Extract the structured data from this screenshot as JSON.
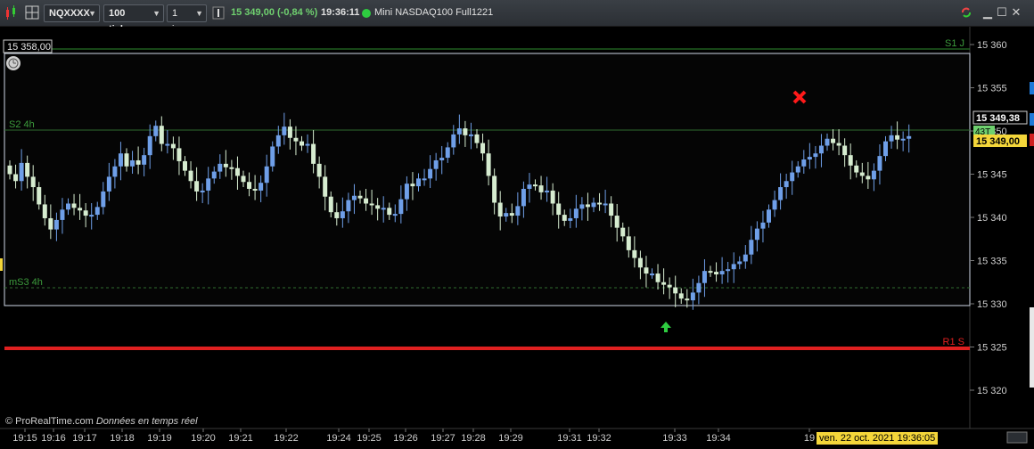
{
  "toolbar": {
    "symbol": "NQXXXX",
    "ticks": "100 ticks",
    "period": "1 jour",
    "price_change": "15 349,00 (-0,84 %)",
    "time": "19:36:11",
    "instrument": "Mini NASDAQ100 Full1221",
    "status_color": "#2ecc40",
    "icons": [
      "chart-type-icon",
      "grid-icon",
      "link-icon",
      "bar-icon",
      "refresh-icon",
      "minimize-icon",
      "maximize-icon",
      "close-icon"
    ]
  },
  "levels": {
    "s1j": "S1 J",
    "s2_4h": "S2 4h",
    "ms3_4h": "mS3 4h",
    "r1s": "R1 S",
    "top_price_label": "15 358,00"
  },
  "price_axis": {
    "ticks": [
      "15 360",
      "15 355",
      "15 350",
      "15 345",
      "15 340",
      "15 335",
      "15 330",
      "15 325",
      "15 320"
    ],
    "tick_values": [
      15360,
      15355,
      15350,
      15345,
      15340,
      15335,
      15330,
      15325,
      15320
    ],
    "last_price": "15 349,38",
    "current_price": "15 349,00",
    "tag": "43T"
  },
  "time_axis": {
    "labels": [
      "19:15",
      "19:16",
      "19:17",
      "19:18",
      "19:19",
      "19:20",
      "19:21",
      "19:22",
      "19:24",
      "19:25",
      "19:26",
      "19:27",
      "19:28",
      "19:29",
      "19:31",
      "19:32",
      "19:33",
      "19:34",
      "19"
    ]
  },
  "footer": {
    "brand": "© ProRealTime.com",
    "note": "Données en temps réel",
    "date": "ven. 22 oct. 2021 19:36:05"
  },
  "chart_data": {
    "type": "candlestick",
    "instrument": "Mini NASDAQ100 Full1221",
    "ylim": [
      15317.5,
      15362
    ],
    "levels": [
      {
        "name": "S1 J",
        "value": 15358.3,
        "color": "#2e8b2e"
      },
      {
        "name": "S2 4h",
        "value": 15349.0,
        "color": "#2e6b2e"
      },
      {
        "name": "mS3 4h",
        "value": 15331.3,
        "color": "#2e6b2e"
      },
      {
        "name": "R1 S",
        "value": 15324.6,
        "color": "#e02020"
      }
    ],
    "colors": {
      "up": "#6f9fe8",
      "down": "#d6ecd0"
    },
    "closes": [
      15345.0,
      15344.2,
      15346.3,
      15344.7,
      15343.5,
      15341.5,
      15339.9,
      15338.6,
      15339.7,
      15340.9,
      15341.6,
      15341.1,
      15340.8,
      15340.2,
      15340.3,
      15341.2,
      15343.0,
      15344.7,
      15345.9,
      15347.4,
      15345.9,
      15346.6,
      15346.1,
      15347.2,
      15349.4,
      15350.6,
      15348.5,
      15348.5,
      15348.0,
      15346.5,
      15345.4,
      15344.2,
      15343.0,
      15343.1,
      15344.5,
      15345.3,
      15346.2,
      15345.8,
      15345.7,
      15344.8,
      15344.1,
      15343.3,
      15343.1,
      15344.0,
      15345.9,
      15348.2,
      15349.5,
      15350.5,
      15349.2,
      15348.8,
      15348.3,
      15348.5,
      15346.2,
      15344.7,
      15342.4,
      15340.6,
      15339.9,
      15340.7,
      15342.0,
      15342.5,
      15342.2,
      15341.6,
      15341.4,
      15341.0,
      15341.1,
      15340.3,
      15340.4,
      15342.1,
      15343.9,
      15343.6,
      15344.5,
      15344.5,
      15345.6,
      15346.6,
      15346.9,
      15348.1,
      15349.6,
      15350.3,
      15349.5,
      15349.6,
      15348.6,
      15347.4,
      15344.8,
      15341.7,
      15340.1,
      15340.5,
      15340.2,
      15341.3,
      15343.3,
      15343.8,
      15343.7,
      15342.9,
      15343.1,
      15341.6,
      15340.3,
      15339.6,
      15339.9,
      15341.0,
      15341.5,
      15341.2,
      15341.7,
      15341.6,
      15341.6,
      15340.2,
      15338.8,
      15337.8,
      15336.2,
      15335.3,
      15334.2,
      15333.5,
      15333.5,
      15332.5,
      15332.2,
      15331.9,
      15331.2,
      15330.6,
      15330.4,
      15331.3,
      15332.4,
      15333.8,
      15333.7,
      15333.4,
      15333.8,
      15334.0,
      15334.6,
      15334.9,
      15335.7,
      15337.4,
      15338.7,
      15339.4,
      15340.9,
      15342.0,
      15343.5,
      15344.2,
      15345.2,
      15345.9,
      15346.7,
      15347.0,
      15347.4,
      15348.3,
      15349.1,
      15348.6,
      15348.3,
      15347.2,
      15346.0,
      15345.2,
      15344.8,
      15344.4,
      15345.4,
      15347.1,
      15348.8,
      15349.5,
      15349.0,
      15349.1,
      15349.4
    ]
  }
}
